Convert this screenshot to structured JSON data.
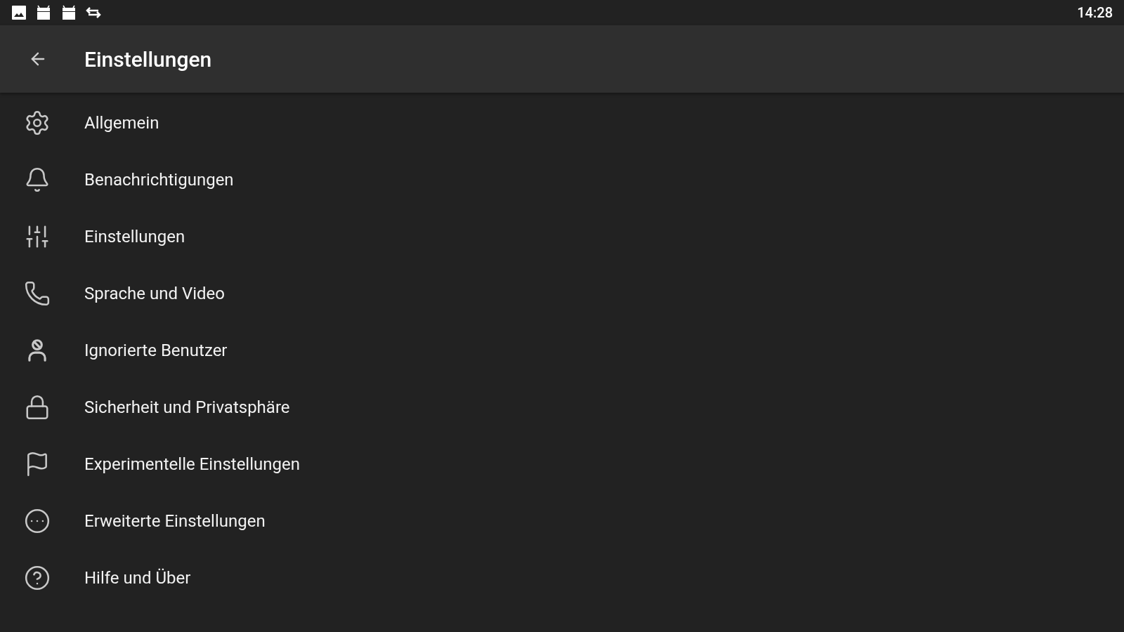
{
  "status_bar": {
    "time": "14:28"
  },
  "header": {
    "title": "Einstellungen"
  },
  "items": [
    {
      "kind": "general",
      "label": "Allgemein"
    },
    {
      "kind": "notifications",
      "label": "Benachrichtigungen"
    },
    {
      "kind": "settings",
      "label": "Einstellungen"
    },
    {
      "kind": "voice",
      "label": "Sprache und Video"
    },
    {
      "kind": "ignored",
      "label": "Ignorierte Benutzer"
    },
    {
      "kind": "security",
      "label": "Sicherheit und Privatsphäre"
    },
    {
      "kind": "experimental",
      "label": "Experimentelle Einstellungen"
    },
    {
      "kind": "advanced",
      "label": "Erweiterte Einstellungen"
    },
    {
      "kind": "help",
      "label": "Hilfe und Über"
    }
  ]
}
